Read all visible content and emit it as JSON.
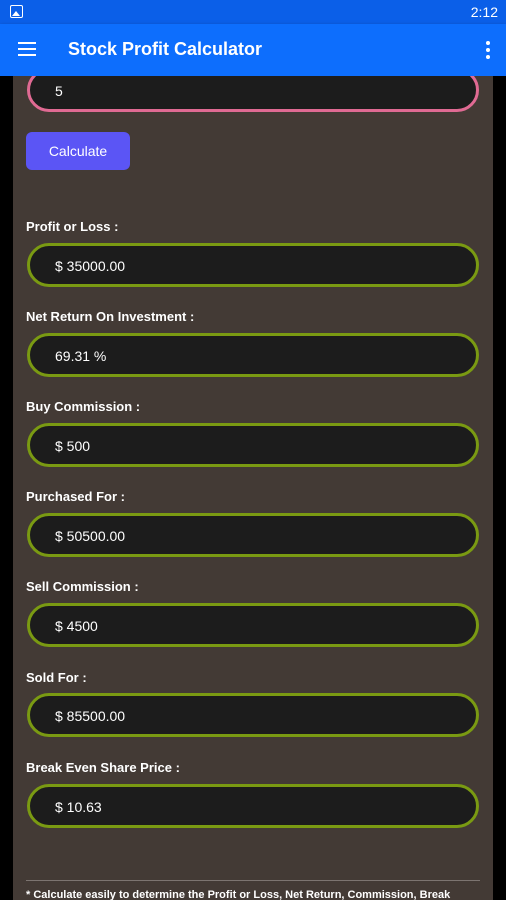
{
  "status_bar": {
    "time": "2:12"
  },
  "app_bar": {
    "title": "Stock Profit Calculator"
  },
  "top_input": {
    "value": "5"
  },
  "calculate_button": {
    "label": "Calculate"
  },
  "results": [
    {
      "label": "Profit or Loss :",
      "value": "$ 35000.00"
    },
    {
      "label": "Net Return On Investment :",
      "value": "69.31 %"
    },
    {
      "label": "Buy Commission :",
      "value": "$ 500"
    },
    {
      "label": "Purchased For :",
      "value": "$ 50500.00"
    },
    {
      "label": "Sell Commission :",
      "value": "$ 4500"
    },
    {
      "label": "Sold For :",
      "value": "$ 85500.00"
    },
    {
      "label": "Break Even Share Price :",
      "value": "$ 10.63"
    }
  ],
  "footnote": "* Calculate easily to determine the Profit or Loss, Net Return, Commission, Break",
  "colors": {
    "app_bar": "#0d6efd",
    "background": "#433a35",
    "field_border": "#7a9a12",
    "input_border": "#e06a93",
    "button": "#5b55f5"
  }
}
